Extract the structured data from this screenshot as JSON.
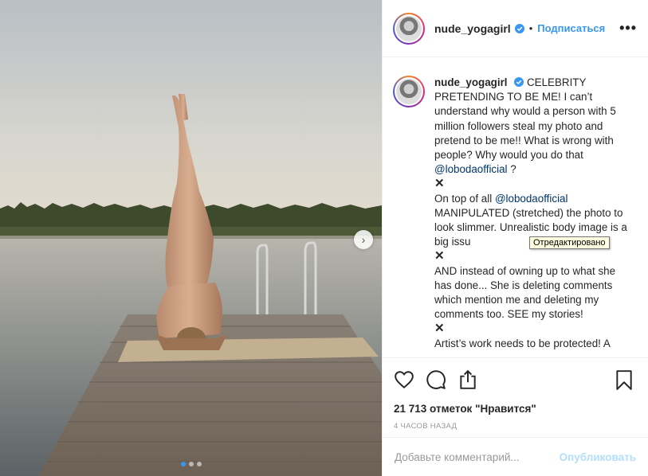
{
  "header": {
    "username": "nude_yogagirl",
    "separator": "•",
    "follow_label": "Подписаться",
    "more_label": "•••"
  },
  "caption": {
    "username": "nude_yogagirl",
    "p1": "CELEBRITY PRETENDING TO BE ME! I can’t understand why would a person with 5 million followers steal my photo and pretend to be me!! What is wrong with people? Why would you do that",
    "mention1": "@lobodaofficial",
    "p1_end": "?",
    "x1": "✕",
    "p2_start": "On top of all",
    "mention2": "@lobodaofficial",
    "p2": "MANIPULATED (stretched) the photo to look slimmer. Unrealistic body image is a big issu",
    "x2": "✕",
    "p3": "AND instead of owning up to what she has done... She is deleting comments which mention me and deleting my comments too. SEE my stories!",
    "x3": "✕",
    "p4": "Artist’s work needs to be protected! A"
  },
  "tooltip": "Отредактировано",
  "icons": {
    "like": "heart-icon",
    "comment": "comment-icon",
    "share": "share-icon",
    "save": "bookmark-icon",
    "next": "chevron-right-icon",
    "verified": "verified-badge-icon"
  },
  "likes": "21 713 отметок \"Нравится\"",
  "time": "4 часов назад",
  "comment": {
    "placeholder": "Добавьте комментарий...",
    "publish_label": "Опубликовать"
  },
  "carousel": {
    "dots": 3,
    "active": 0,
    "next_glyph": "›"
  },
  "colors": {
    "accent": "#3897f0",
    "verified": "#3897f0",
    "publish_disabled": "#b2dffc"
  }
}
